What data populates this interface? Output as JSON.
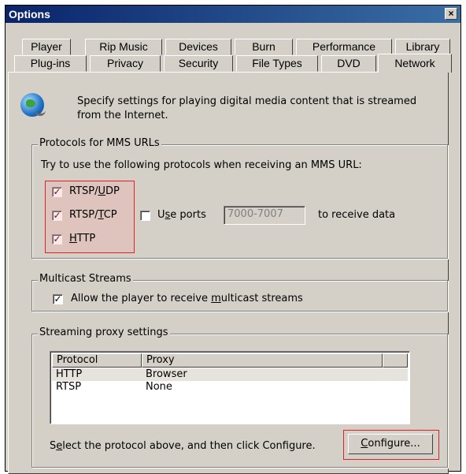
{
  "window": {
    "title": "Options",
    "close_glyph": "×"
  },
  "tabs_row1": [
    "Player",
    "Rip Music",
    "Devices",
    "Burn",
    "Performance",
    "Library"
  ],
  "tabs_row2": [
    "Plug-ins",
    "Privacy",
    "Security",
    "File Types",
    "DVD",
    "Network"
  ],
  "active_tab": "Network",
  "intro": {
    "icon": "network-globe-icon",
    "line1": "Specify settings for playing digital media content that is streamed",
    "line2": "from the Internet."
  },
  "mms": {
    "legend": "Protocols for MMS URLs",
    "instruction": "Try to use the following protocols when receiving an MMS URL:",
    "rtsp_udp": {
      "prefix": "RTSP/",
      "accel": "U",
      "suffix": "DP",
      "checked": true
    },
    "rtsp_tcp": {
      "prefix": "RTSP/",
      "accel": "T",
      "suffix": "CP",
      "checked": true
    },
    "http": {
      "prefix": "",
      "accel": "H",
      "suffix": "TTP",
      "checked": true
    },
    "use_ports": {
      "prefix": "U",
      "accel": "s",
      "suffix": "e ports",
      "checked": false
    },
    "ports_value": "7000-7007",
    "receive_text": "to receive data"
  },
  "multicast": {
    "legend": "Multicast Streams",
    "allow": {
      "prefix": "Allow the player to receive ",
      "accel": "m",
      "suffix": "ulticast streams",
      "checked": true
    }
  },
  "proxy": {
    "legend": "Streaming proxy settings",
    "columns": [
      "Protocol",
      "Proxy"
    ],
    "rows": [
      {
        "protocol": "HTTP",
        "proxy": "Browser"
      },
      {
        "protocol": "RTSP",
        "proxy": "None"
      }
    ],
    "hint": {
      "prefix": "S",
      "accel": "e",
      "suffix": "lect the protocol above, and then click Configure."
    },
    "configure": {
      "accel": "C",
      "suffix": "onfigure..."
    }
  },
  "colors": {
    "titlebar_start": "#0a246a",
    "titlebar_end": "#3a6ea5",
    "dialog_face": "#d4d0c8",
    "highlight_border": "#e0202a"
  }
}
